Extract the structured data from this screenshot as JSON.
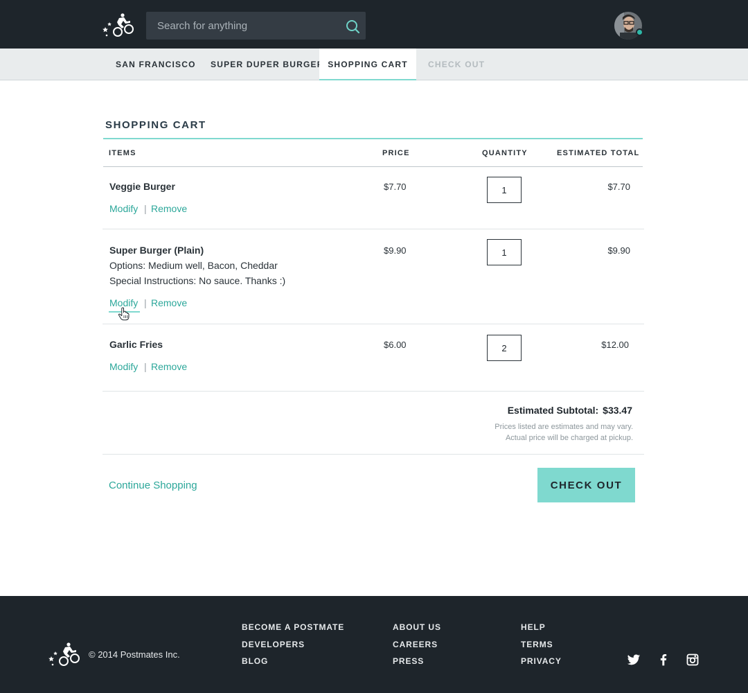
{
  "header": {
    "search_placeholder": "Search for anything",
    "icons": [
      "postmates-logo",
      "search-icon",
      "avatar"
    ]
  },
  "breadcrumbs": [
    {
      "label": "SAN FRANCISCO",
      "state": "link"
    },
    {
      "label": "SUPER DUPER BURGER",
      "state": "link"
    },
    {
      "label": "SHOPPING CART",
      "state": "active"
    },
    {
      "label": "CHECK OUT",
      "state": "disabled"
    }
  ],
  "cart": {
    "title": "SHOPPING CART",
    "columns": {
      "items": "ITEMS",
      "price": "PRICE",
      "quantity": "QUANTITY",
      "total": "ESTIMATED TOTAL"
    },
    "items": [
      {
        "name": "Veggie Burger",
        "options": "",
        "instructions": "",
        "price": "$7.70",
        "quantity": "1",
        "total": "$7.70",
        "modify": "Modify",
        "remove": "Remove"
      },
      {
        "name": "Super Burger (Plain)",
        "options": "Options: Medium well, Bacon, Cheddar",
        "instructions": "Special Instructions: No sauce. Thanks :)",
        "price": "$9.90",
        "quantity": "1",
        "total": "$9.90",
        "modify": "Modify",
        "remove": "Remove"
      },
      {
        "name": "Garlic Fries",
        "options": "",
        "instructions": "",
        "price": "$6.00",
        "quantity": "2",
        "total": "$12.00",
        "modify": "Modify",
        "remove": "Remove"
      }
    ],
    "separator": "|",
    "subtotal_label": "Estimated Subtotal:",
    "subtotal_value": "$33.47",
    "disclaimer_line1": "Prices listed are estimates and may vary.",
    "disclaimer_line2": "Actual price will be charged at pickup.",
    "continue_label": "Continue Shopping",
    "checkout_label": "CHECK OUT"
  },
  "footer": {
    "copyright": "© 2014 Postmates Inc.",
    "columns": [
      [
        "BECOME A POSTMATE",
        "DEVELOPERS",
        "BLOG"
      ],
      [
        "ABOUT US",
        "CAREERS",
        "PRESS"
      ],
      [
        "HELP",
        "TERMS",
        "PRIVACY"
      ]
    ],
    "social_icons": [
      "twitter-icon",
      "facebook-icon",
      "instagram-icon"
    ]
  },
  "colors": {
    "dark": "#1e252b",
    "accent": "#7fd9cf",
    "link": "#2ca79a",
    "crumb_bg": "#e9eced"
  }
}
